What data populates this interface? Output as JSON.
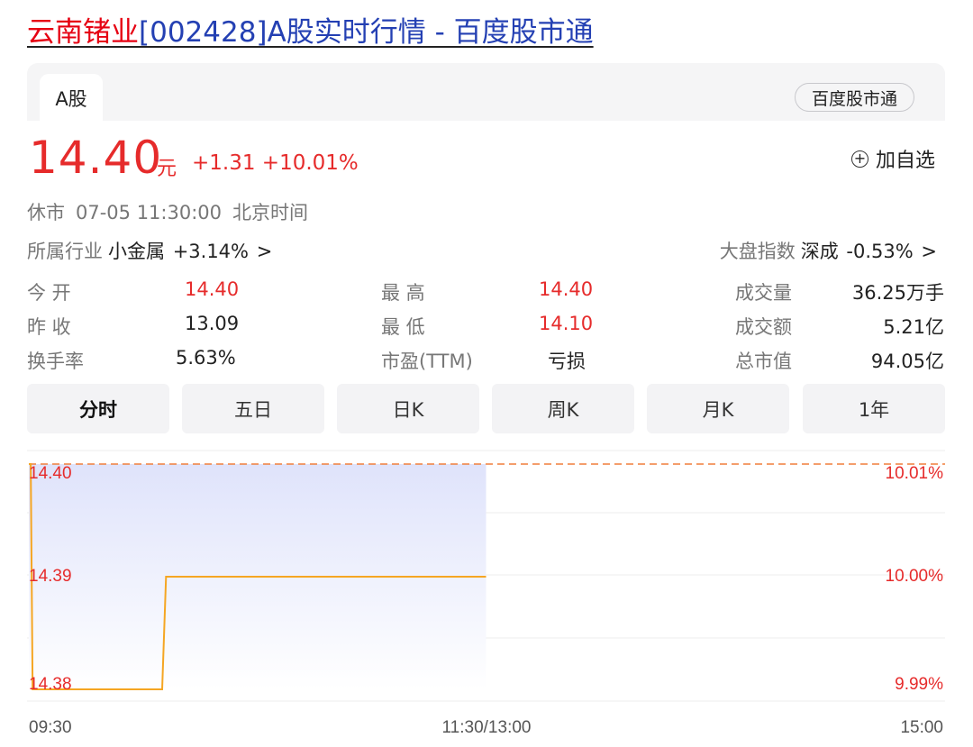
{
  "header": {
    "title_name": "云南锗业",
    "title_rest": "[002428]A股实时行情 - 百度股市通"
  },
  "card": {
    "tab_label": "A股",
    "brand_button": "百度股市通"
  },
  "quote": {
    "price": "14.40",
    "unit": "元",
    "change": "+1.31",
    "change_pct": "+10.01%",
    "watch_label": "加自选",
    "watch_icon": "plus-circle-icon",
    "status": "休市",
    "datetime": "07-05 11:30:00",
    "timezone": "北京时间"
  },
  "industry": {
    "label": "所属行业",
    "name": "小金属",
    "change": "+3.14%",
    "arrow": ">"
  },
  "market_index": {
    "label": "大盘指数",
    "name": "深成",
    "change": "-0.53%",
    "arrow": ">"
  },
  "stats": [
    {
      "label": "今  开",
      "value": "14.40",
      "color": "red"
    },
    {
      "label": "昨  收",
      "value": "13.09",
      "color": "black"
    },
    {
      "label": "换手率",
      "value": "5.63%",
      "color": "black"
    },
    {
      "label": "最  高",
      "value": "14.40",
      "color": "red"
    },
    {
      "label": "最  低",
      "value": "14.10",
      "color": "red"
    },
    {
      "label": "市盈(TTM)",
      "value": "亏损",
      "color": "black"
    },
    {
      "label": "成交量",
      "value": "36.25万手",
      "color": "black"
    },
    {
      "label": "成交额",
      "value": "5.21亿",
      "color": "black"
    },
    {
      "label": "总市值",
      "value": "94.05亿",
      "color": "black"
    }
  ],
  "period_tabs": [
    "分时",
    "五日",
    "日K",
    "周K",
    "月K",
    "1年"
  ],
  "active_tab": "分时",
  "colors": {
    "up_red": "#e62b2b",
    "title_red": "#e60012",
    "title_blue": "#2440b3",
    "line_orange": "#f5a623",
    "prev_close_dash": "#f07f3c",
    "fill_blue": "#dfe3fb"
  },
  "chart_data": {
    "type": "line",
    "y_left_ticks": [
      "14.40",
      "14.39",
      "14.38"
    ],
    "y_right_ticks": [
      "10.01%",
      "10.00%",
      "9.99%"
    ],
    "x_ticks": [
      "09:30",
      "11:30/13:00",
      "15:00"
    ],
    "ylim": [
      14.38,
      14.4
    ],
    "reference_line": 14.4,
    "session_minutes": 240,
    "series": [
      {
        "points": [
          [
            0,
            14.4
          ],
          [
            0.5,
            14.4
          ],
          [
            1,
            14.38
          ],
          [
            35,
            14.38
          ],
          [
            36,
            14.39
          ],
          [
            120,
            14.39
          ]
        ]
      }
    ]
  }
}
